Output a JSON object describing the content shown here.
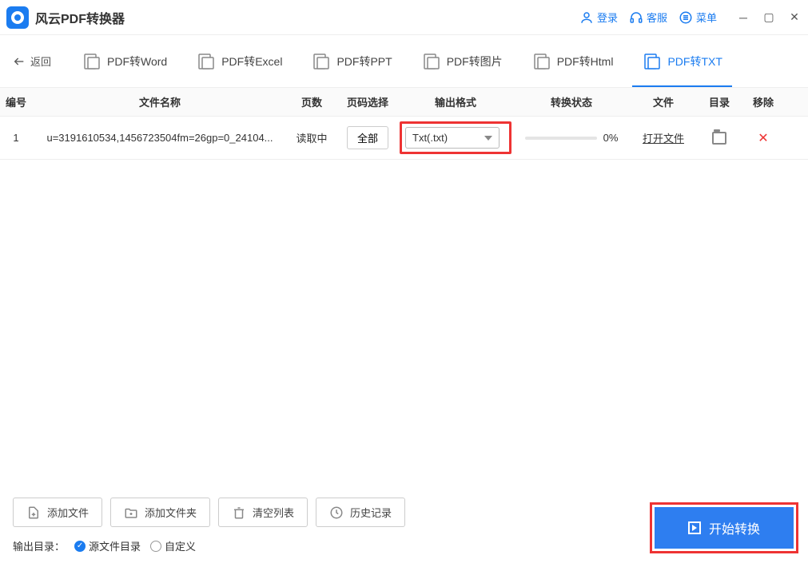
{
  "titlebar": {
    "app_name": "风云PDF转换器",
    "login": "登录",
    "service": "客服",
    "menu": "菜单"
  },
  "nav": {
    "back": "返回",
    "tabs": [
      {
        "label": "PDF转Word"
      },
      {
        "label": "PDF转Excel"
      },
      {
        "label": "PDF转PPT"
      },
      {
        "label": "PDF转图片"
      },
      {
        "label": "PDF转Html"
      },
      {
        "label": "PDF转TXT"
      }
    ]
  },
  "table": {
    "headers": {
      "num": "编号",
      "name": "文件名称",
      "pages": "页数",
      "pagesel": "页码选择",
      "format": "输出格式",
      "status": "转换状态",
      "file": "文件",
      "dir": "目录",
      "del": "移除"
    },
    "rows": [
      {
        "num": "1",
        "name": "u=3191610534,1456723504fm=26gp=0_24104...",
        "pages": "读取中",
        "pagesel": "全部",
        "format": "Txt(.txt)",
        "progress": "0%",
        "file": "打开文件"
      }
    ]
  },
  "bottom": {
    "add_file": "添加文件",
    "add_folder": "添加文件夹",
    "clear": "清空列表",
    "history": "历史记录",
    "out_label": "输出目录：",
    "radio_src": "源文件目录",
    "radio_custom": "自定义",
    "start": "开始转换"
  }
}
